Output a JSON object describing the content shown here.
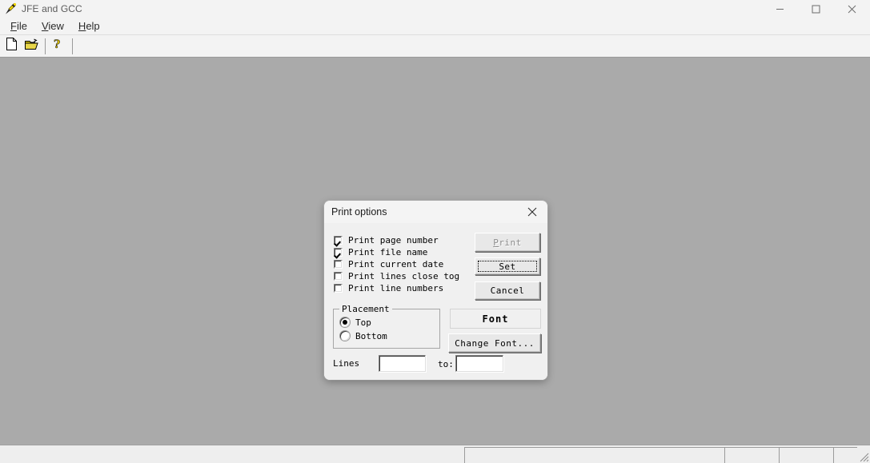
{
  "window": {
    "title": "JFE and GCC",
    "app_icon": "quill-pen-icon",
    "controls": {
      "minimize": "minimize-icon",
      "maximize": "maximize-icon",
      "close": "close-icon"
    }
  },
  "menubar": {
    "items": [
      {
        "label": "File",
        "mnemonic": "F"
      },
      {
        "label": "View",
        "mnemonic": "V"
      },
      {
        "label": "Help",
        "mnemonic": "H"
      }
    ]
  },
  "toolbar": {
    "buttons": [
      {
        "name": "new-file-icon",
        "tooltip": "New"
      },
      {
        "name": "open-folder-icon",
        "tooltip": "Open"
      },
      {
        "name": "help-question-icon",
        "tooltip": "Help"
      }
    ]
  },
  "statusbar": {
    "panes": [
      "",
      "",
      "",
      ""
    ]
  },
  "dialog": {
    "title": "Print options",
    "close_label": "✕",
    "checkboxes": [
      {
        "label": "Print page number",
        "checked": true
      },
      {
        "label": "Print file name",
        "checked": true
      },
      {
        "label": "Print current date",
        "checked": false
      },
      {
        "label": "Print lines close tog",
        "checked": false
      },
      {
        "label": "Print line numbers",
        "checked": false
      }
    ],
    "buttons": {
      "print": {
        "label": "Print",
        "mnemonic": "P",
        "disabled": true
      },
      "set": {
        "label": "Set",
        "focused": true
      },
      "cancel": {
        "label": "Cancel"
      },
      "change_font": {
        "label": "Change Font..."
      }
    },
    "font_panel": {
      "label": "Font"
    },
    "placement": {
      "legend": "Placement",
      "options": [
        {
          "label": "Top",
          "selected": true
        },
        {
          "label": "Bottom",
          "selected": false
        }
      ]
    },
    "lines": {
      "label": "Lines",
      "from_value": "",
      "to_label": "to:",
      "to_value": ""
    }
  }
}
